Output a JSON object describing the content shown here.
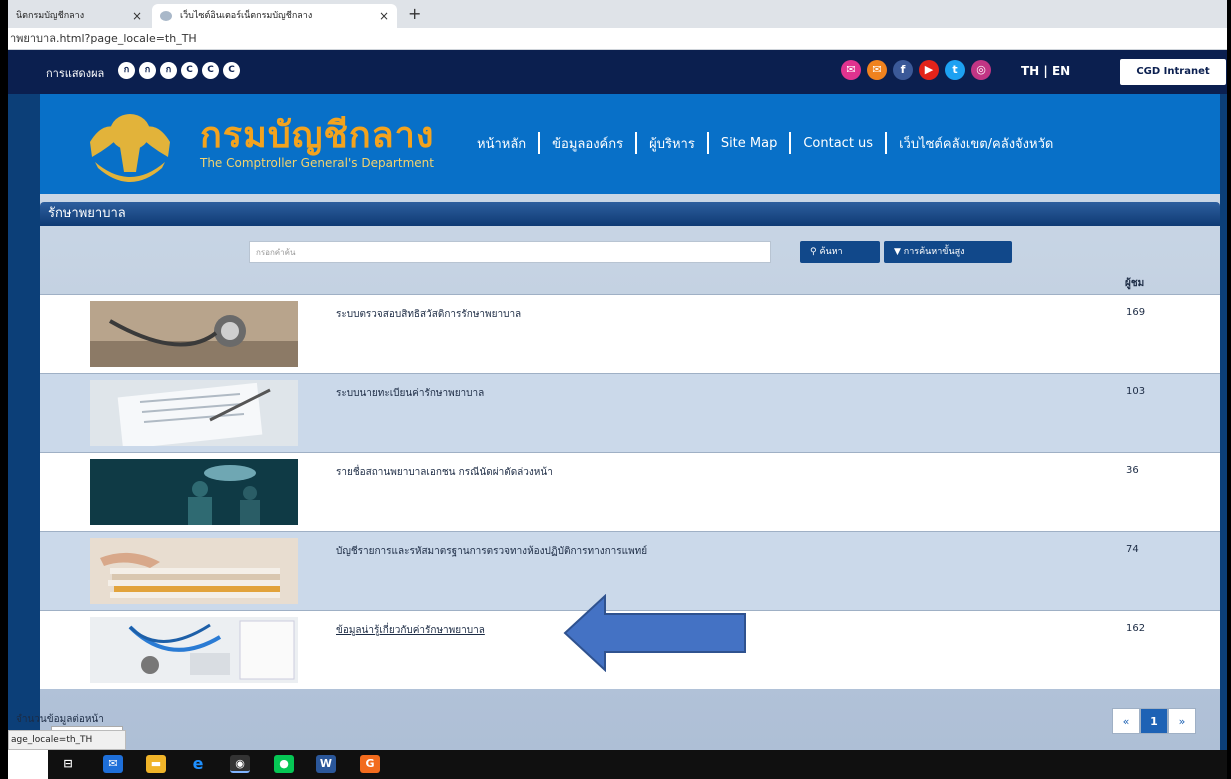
{
  "browser": {
    "tabs": [
      {
        "label": "นิตกรมบัญชีกลาง"
      },
      {
        "label": "เว็บไซต์อินเตอร์เน็ตกรมบัญชีกลาง"
      }
    ],
    "new_tab": "+",
    "close_glyph": "×",
    "url": "าพยาบาล.html?page_locale=th_TH",
    "status_url": "age_locale=th_TH"
  },
  "topbar": {
    "display_label": "การแสดงผล",
    "display_options": [
      "ก",
      "ก",
      "ก",
      "C",
      "C",
      "C"
    ],
    "social": [
      {
        "icon": "mail-icon",
        "glyph": "✉",
        "color": "#e0338f"
      },
      {
        "icon": "envelope-icon",
        "glyph": "✉",
        "color": "#f0821e"
      },
      {
        "icon": "facebook-icon",
        "glyph": "f",
        "color": "#3b5998"
      },
      {
        "icon": "youtube-icon",
        "glyph": "▶",
        "color": "#e2231a"
      },
      {
        "icon": "twitter-icon",
        "glyph": "t",
        "color": "#1da1f2"
      },
      {
        "icon": "instagram-icon",
        "glyph": "◎",
        "color": "#c13584"
      }
    ],
    "lang": "TH | EN",
    "intranet": "CGD Intranet"
  },
  "header": {
    "brand_th": "กรมบัญชีกลาง",
    "brand_en": "The Comptroller General's Department",
    "nav": [
      "หน้าหลัก",
      "ข้อมูลองค์กร",
      "ผู้บริหาร",
      "Site Map",
      "Contact us",
      "เว็บไซต์คลังเขต/คลังจังหวัด"
    ]
  },
  "section": {
    "title": "รักษาพยาบาล",
    "search_placeholder": "กรอกคำค้น",
    "search_button": "ค้นหา",
    "advanced_button": "การค้นหาขั้นสูง",
    "views_header": "ผู้ชม"
  },
  "rows": [
    {
      "title": "ระบบตรวจสอบสิทธิสวัสดิการรักษาพยาบาล",
      "count": "169"
    },
    {
      "title": "ระบบนายทะเบียนค่ารักษาพยาบาล",
      "count": "103"
    },
    {
      "title": "รายชื่อสถานพยาบาลเอกชน กรณีนัดผ่าตัดล่วงหน้า",
      "count": "36"
    },
    {
      "title": "บัญชีรายการและรหัสมาตรฐานการตรวจทางห้องปฏิบัติการทางการแพทย์",
      "count": "74"
    },
    {
      "title": "ข้อมูลน่ารู้เกี่ยวกับค่ารักษาพยาบาล",
      "count": "162"
    }
  ],
  "footer": {
    "per_page_label": "จำนวนข้อมูลต่อหน้า",
    "prev": "«",
    "page": "1",
    "next": "»"
  },
  "colors": {
    "header_blue": "#0870c8",
    "brand_orange": "#f3a31e",
    "arrow_blue": "#4472c4"
  }
}
